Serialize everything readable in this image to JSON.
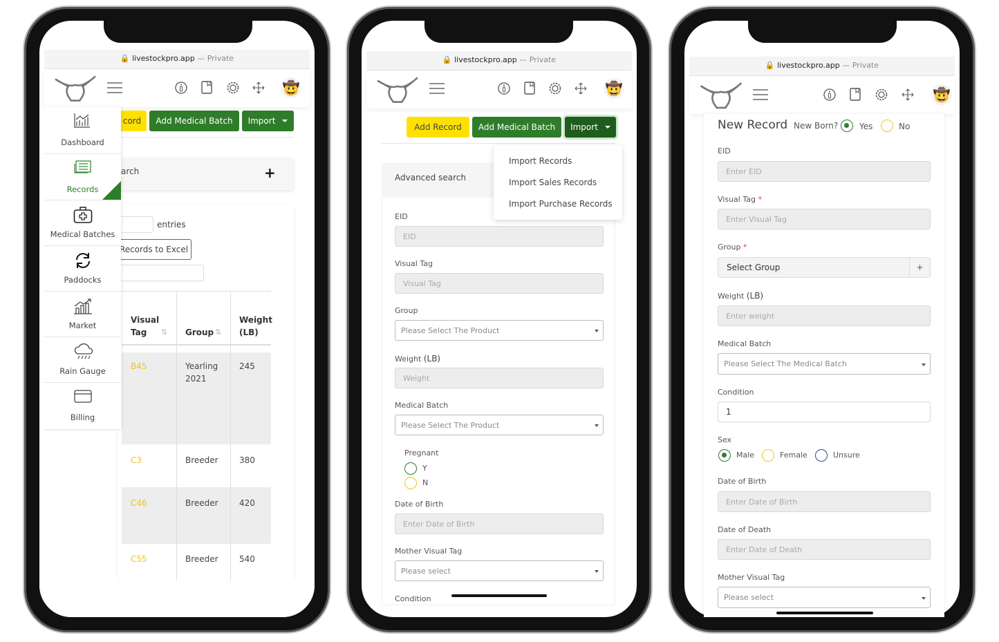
{
  "browser": {
    "domain": "livestockpro.app",
    "private": "— Private"
  },
  "icons": [
    "logo-bull-icon",
    "hamburger-icon",
    "info-icon",
    "book-icon",
    "gear-icon",
    "move-icon",
    "avatar-cowboy-icon"
  ],
  "phone1": {
    "buttons": {
      "add_record": "cord",
      "add_medical_batch": "Add Medical Batch",
      "import": "Import"
    },
    "advanced_search": "arch",
    "entries": "entries",
    "export": "Records to Excel",
    "sidebar": [
      {
        "label": "Dashboard",
        "icon": "chart-icon"
      },
      {
        "label": "Records",
        "icon": "records-icon",
        "active": true
      },
      {
        "label": "Medical Batches",
        "icon": "medical-kit-icon"
      },
      {
        "label": "Paddocks",
        "icon": "refresh-icon"
      },
      {
        "label": "Market",
        "icon": "market-icon"
      },
      {
        "label": "Rain Gauge",
        "icon": "rain-cloud-icon"
      },
      {
        "label": "Billing",
        "icon": "card-icon"
      }
    ],
    "table": {
      "headers": {
        "visual_tag_1": "Visual",
        "visual_tag_2": "Tag",
        "group": "Group",
        "weight_1": "Weight",
        "weight_2": "(LB)"
      },
      "rows": [
        {
          "tag": "B45",
          "group_1": "Yearling",
          "group_2": "2021",
          "weight": "245"
        },
        {
          "tag": "C3",
          "group_1": "Breeder",
          "weight": "380"
        },
        {
          "tag": "C46",
          "group_1": "Breeder",
          "weight": "420"
        },
        {
          "tag": "C55",
          "group_1": "Breeder",
          "weight": "540"
        }
      ]
    }
  },
  "phone2": {
    "buttons": {
      "add_record": "Add Record",
      "add_medical_batch": "Add Medical Batch",
      "import": "Import"
    },
    "import_menu": [
      "Import Records",
      "Import Sales Records",
      "Import Purchase Records"
    ],
    "advanced_search": "Advanced search",
    "form": {
      "eid_label": "EID",
      "eid_placeholder": "EID",
      "visual_tag_label": "Visual Tag",
      "visual_tag_placeholder": "Visual Tag",
      "group_label": "Group",
      "group_value": "Please Select The Product",
      "weight_label": "Weight",
      "weight_unit": "(LB)",
      "weight_placeholder": "Weight",
      "medical_batch_label": "Medical Batch",
      "medical_batch_value": "Please Select The Product",
      "pregnant_label": "Pregnant",
      "pregnant_options": [
        "Y",
        "N"
      ],
      "dob_label": "Date of Birth",
      "dob_placeholder": "Enter Date of Birth",
      "mother_label": "Mother Visual Tag",
      "mother_value": "Please select",
      "condition_label": "Condition"
    }
  },
  "phone3": {
    "title": "New Record",
    "new_born_label": "New Born?",
    "new_born_options": [
      "Yes",
      "No"
    ],
    "new_born_selected": "Yes",
    "form": {
      "eid_label": "EID",
      "eid_placeholder": "Enter EID",
      "visual_tag_label": "Visual Tag",
      "visual_tag_placeholder": "Enter Visual Tag",
      "required": "*",
      "group_label": "Group",
      "group_value": "Select Group",
      "group_add": "+",
      "weight_label": "Weight",
      "weight_unit": "(LB)",
      "weight_placeholder": "Enter weight",
      "medical_batch_label": "Medical Batch",
      "medical_batch_value": "Please Select The Medical Batch",
      "condition_label": "Condition",
      "condition_value": "1",
      "sex_label": "Sex",
      "sex_options": [
        "Male",
        "Female",
        "Unsure"
      ],
      "sex_selected": "Male",
      "dob_label": "Date of Birth",
      "dob_placeholder": "Enter Date of Birth",
      "dod_label": "Date of Death",
      "dod_placeholder": "Enter Date of Death",
      "mother_label": "Mother Visual Tag",
      "mother_value": "Please select"
    }
  },
  "colors": {
    "green": "#2f7d2a",
    "yellow": "#ffe100",
    "tag_yellow": "#f0c419",
    "radio_blue": "#2b4c8c"
  }
}
